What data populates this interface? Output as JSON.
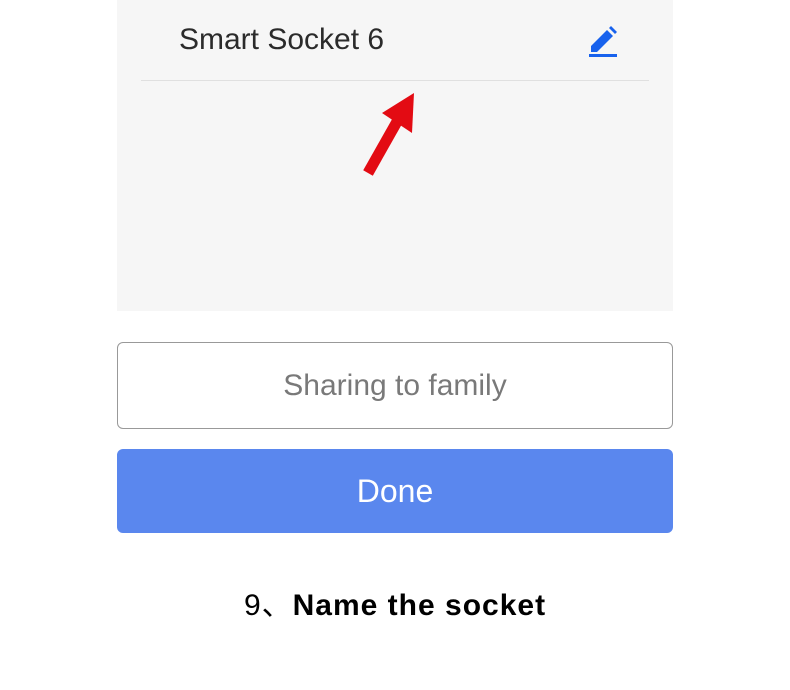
{
  "device": {
    "name": "Smart Socket 6"
  },
  "buttons": {
    "sharing_label": "Sharing to family",
    "done_label": "Done"
  },
  "icons": {
    "edit": "edit-icon"
  },
  "caption": {
    "number": "9、",
    "text": "Name the socket"
  },
  "colors": {
    "accent": "#1862ed",
    "primary_button": "#5a87ee",
    "annotation": "#e30b13"
  }
}
